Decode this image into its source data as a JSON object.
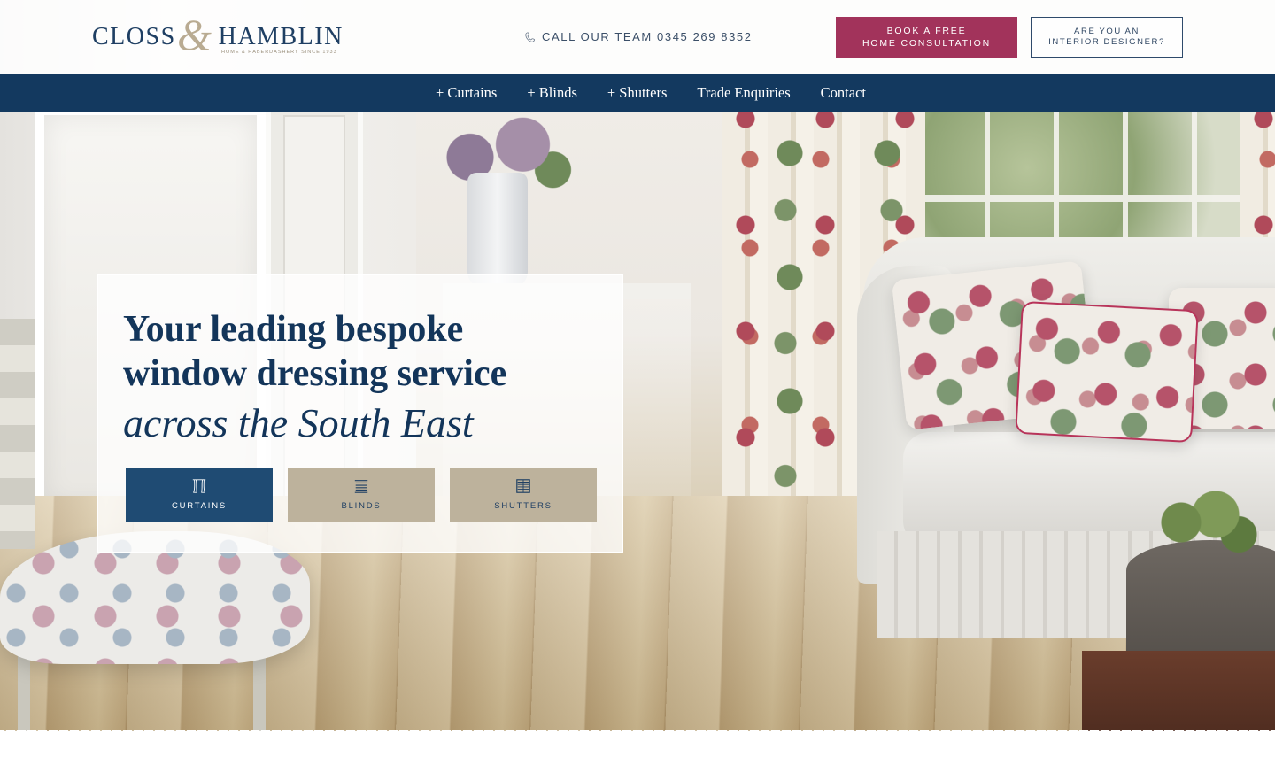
{
  "brand": {
    "name_left": "CLOSS",
    "ampersand": "&",
    "name_right": "HAMBLIN",
    "tagline": "HOME & HABERDASHERY SINCE 1933"
  },
  "header": {
    "phone_label": "CALL OUR TEAM 0345 269 8352",
    "phone_icon": "phone-icon",
    "consult_button": {
      "line1": "BOOK A FREE",
      "line2": "HOME CONSULTATION"
    },
    "designer_button": {
      "line1": "ARE YOU AN",
      "line2": "INTERIOR DESIGNER?"
    }
  },
  "nav": {
    "items": [
      {
        "label": "+ Curtains"
      },
      {
        "label": "+ Blinds"
      },
      {
        "label": "+ Shutters"
      },
      {
        "label": "Trade Enquiries"
      },
      {
        "label": "Contact"
      }
    ]
  },
  "hero": {
    "headline_line1": "Your leading bespoke",
    "headline_line2": "window dressing service",
    "headline_italic": "across the South East",
    "categories": [
      {
        "label": "CURTAINS",
        "icon": "curtains-icon"
      },
      {
        "label": "BLINDS",
        "icon": "blinds-icon"
      },
      {
        "label": "SHUTTERS",
        "icon": "shutters-icon"
      }
    ]
  },
  "colors": {
    "navy": "#13395f",
    "brand_plum": "#a2335b",
    "stone": "#bdb29c",
    "button_blue": "#1f4b73"
  }
}
